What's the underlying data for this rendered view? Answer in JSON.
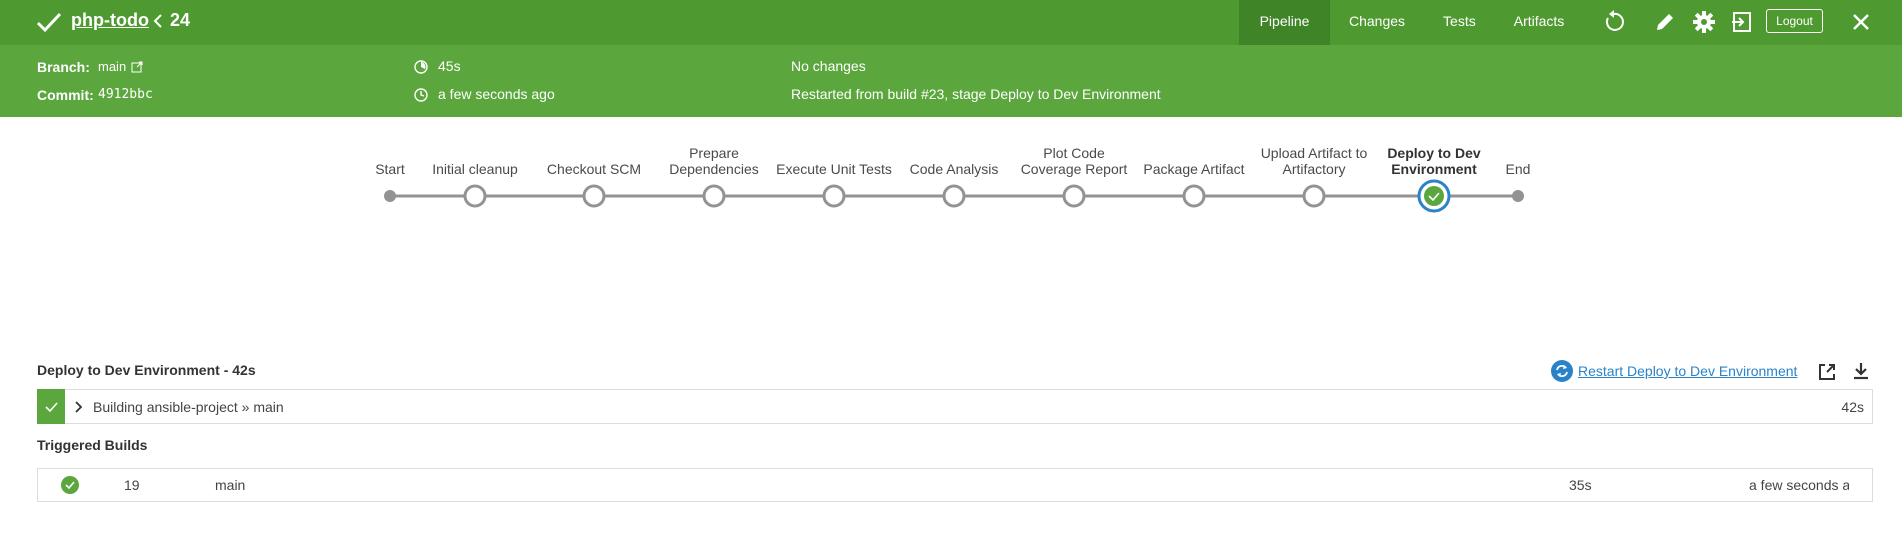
{
  "header": {
    "pipeline_name": "php-todo",
    "run_number": "24",
    "tabs": [
      {
        "label": "Pipeline",
        "active": true
      },
      {
        "label": "Changes",
        "active": false
      },
      {
        "label": "Tests",
        "active": false
      },
      {
        "label": "Artifacts",
        "active": false
      }
    ],
    "icons": [
      "replay-icon",
      "edit-icon",
      "gear-icon",
      "exit-icon"
    ],
    "logout_label": "Logout",
    "close_icon": "close-icon",
    "color": "#4e9a31"
  },
  "summary": {
    "branch_label": "Branch:",
    "branch_value": "main",
    "commit_label": "Commit:",
    "commit_value": "4912bbc",
    "duration": "45s",
    "time_ago": "a few seconds ago",
    "changes": "No changes",
    "cause": "Restarted from build #23, stage Deploy to Dev Environment"
  },
  "pipeline": {
    "stages": [
      {
        "label": "Start",
        "kind": "terminal"
      },
      {
        "label": "Initial cleanup",
        "kind": "stage"
      },
      {
        "label": "Checkout SCM",
        "kind": "stage"
      },
      {
        "label": "Prepare Dependencies",
        "kind": "stage"
      },
      {
        "label": "Execute Unit Tests",
        "kind": "stage"
      },
      {
        "label": "Code Analysis",
        "kind": "stage"
      },
      {
        "label": "Plot Code Coverage Report",
        "kind": "stage"
      },
      {
        "label": "Package Artifact",
        "kind": "stage"
      },
      {
        "label": "Upload Artifact to Artifactory",
        "kind": "stage"
      },
      {
        "label": "Deploy to Dev Environment",
        "kind": "selected-success"
      },
      {
        "label": "End",
        "kind": "terminal"
      }
    ]
  },
  "stage_detail": {
    "title": "Deploy to Dev Environment - 42s",
    "restart_label": "Restart Deploy to Dev Environment",
    "steps": [
      {
        "text": "Building ansible-project » main",
        "duration": "42s",
        "status": "success"
      }
    ]
  },
  "triggered": {
    "title": "Triggered Builds",
    "rows": [
      {
        "status": "success",
        "number": "19",
        "branch": "main",
        "duration": "35s",
        "time_ago": "a few seconds ago"
      }
    ]
  },
  "colors": {
    "success": "#5ba73d",
    "selected_ring": "#2a83c9",
    "node": "#949393",
    "link": "#2a83c9"
  }
}
